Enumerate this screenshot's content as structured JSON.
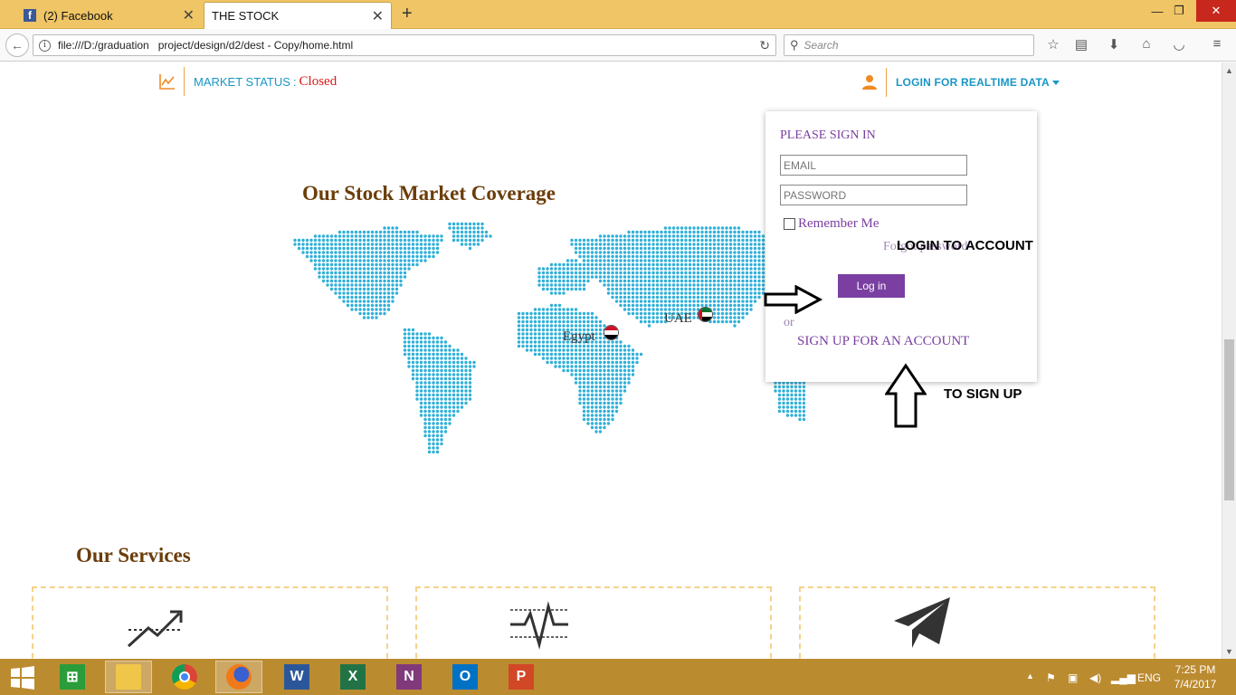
{
  "browser": {
    "tabs": [
      {
        "title": "(2) Facebook",
        "favicon": "facebook-icon"
      },
      {
        "title": "THE STOCK",
        "active": true
      }
    ],
    "url": "file:///D:/graduation   project/design/d2/dest - Copy/home.html",
    "search_placeholder": "Search"
  },
  "header": {
    "market_status_label": "MARKET STATUS",
    "market_status_colon": ":",
    "market_status_value": "Closed",
    "login_link": "LOGIN FOR REALTIME DATA"
  },
  "coverage": {
    "title": "Our Stock Market Coverage",
    "markers": [
      {
        "label": "Egypt",
        "flag": "egypt-flag"
      },
      {
        "label": "UAE",
        "flag": "uae-flag"
      }
    ]
  },
  "signin_dropdown": {
    "title": "PLEASE SIGN IN",
    "email_placeholder": "EMAIL",
    "password_placeholder": "PASSWORD",
    "remember_me": "Remember Me",
    "forgot": "Forgot password",
    "login_button": "Log in",
    "or": "or",
    "signup_link": "SIGN UP FOR AN ACCOUNT"
  },
  "annotations": {
    "login": "LOGIN TO ACCOUNT",
    "signup": "TO SIGN UP"
  },
  "services": {
    "title": "Our Services",
    "cards": [
      {
        "icon": "trend-up-icon"
      },
      {
        "icon": "pulse-chart-icon"
      },
      {
        "icon": "paper-plane-icon"
      }
    ]
  },
  "taskbar": {
    "apps": [
      "file-explorer",
      "chrome",
      "firefox",
      "word",
      "excel",
      "onenote",
      "outlook",
      "powerpoint"
    ],
    "language": "ENG",
    "time": "7:25 PM",
    "date": "7/4/2017"
  },
  "colors": {
    "accent_blue": "#1996c6",
    "brand_purple": "#7a3fa1",
    "heading_brown": "#6b3d0a",
    "status_red": "#d81818",
    "map_dots": "#2fb0d8"
  }
}
